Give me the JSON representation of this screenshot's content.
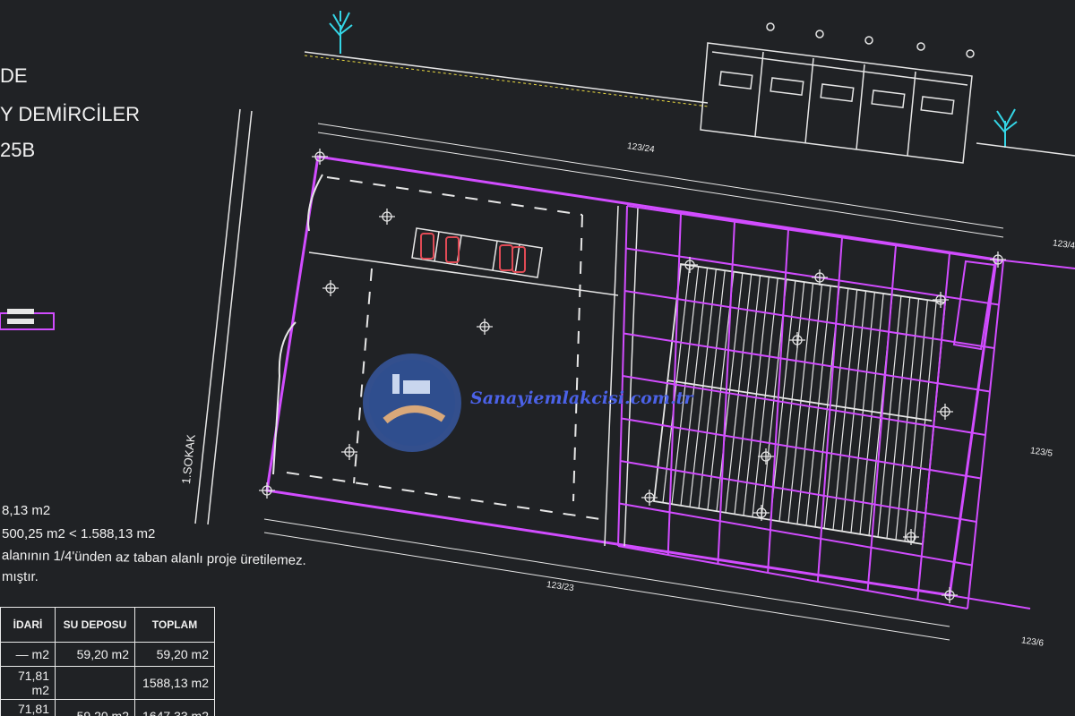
{
  "title_block": {
    "line1": "DE",
    "line2": "Y DEMİRCİLER",
    "line3": "25B"
  },
  "street_label": "1.SOKAK",
  "notes": {
    "area1": "8,13 m2",
    "area2": "500,25 m2 < 1.588,13 m2",
    "rule": "alanının 1/4'ünden az taban alanlı proje üretilemez.",
    "tail": "mıştır."
  },
  "area_table": {
    "headers": [
      "İDARİ",
      "SU DEPOSU",
      "TOPLAM"
    ],
    "rows": [
      [
        "— m2",
        "59,20 m2",
        "59,20 m2"
      ],
      [
        "71,81 m2",
        "",
        "1588,13 m2"
      ],
      [
        "71,81 m2",
        "59,20 m2",
        "1647,33 m2"
      ]
    ]
  },
  "parcel_labels": {
    "top": "123/24",
    "bottom": "123/23",
    "right_top": "123/4",
    "right_mid": "123/5",
    "right_bottom": "123/6"
  },
  "watermark": "Sanayiemlakcisi.com.tr",
  "colors": {
    "background": "#202225",
    "line_white": "#e6e6e6",
    "parcel_magenta": "#d14cff",
    "parking_red": "#e04a55",
    "tree_cyan": "#34d6e6",
    "watermark_blue": "#4b62e8"
  }
}
